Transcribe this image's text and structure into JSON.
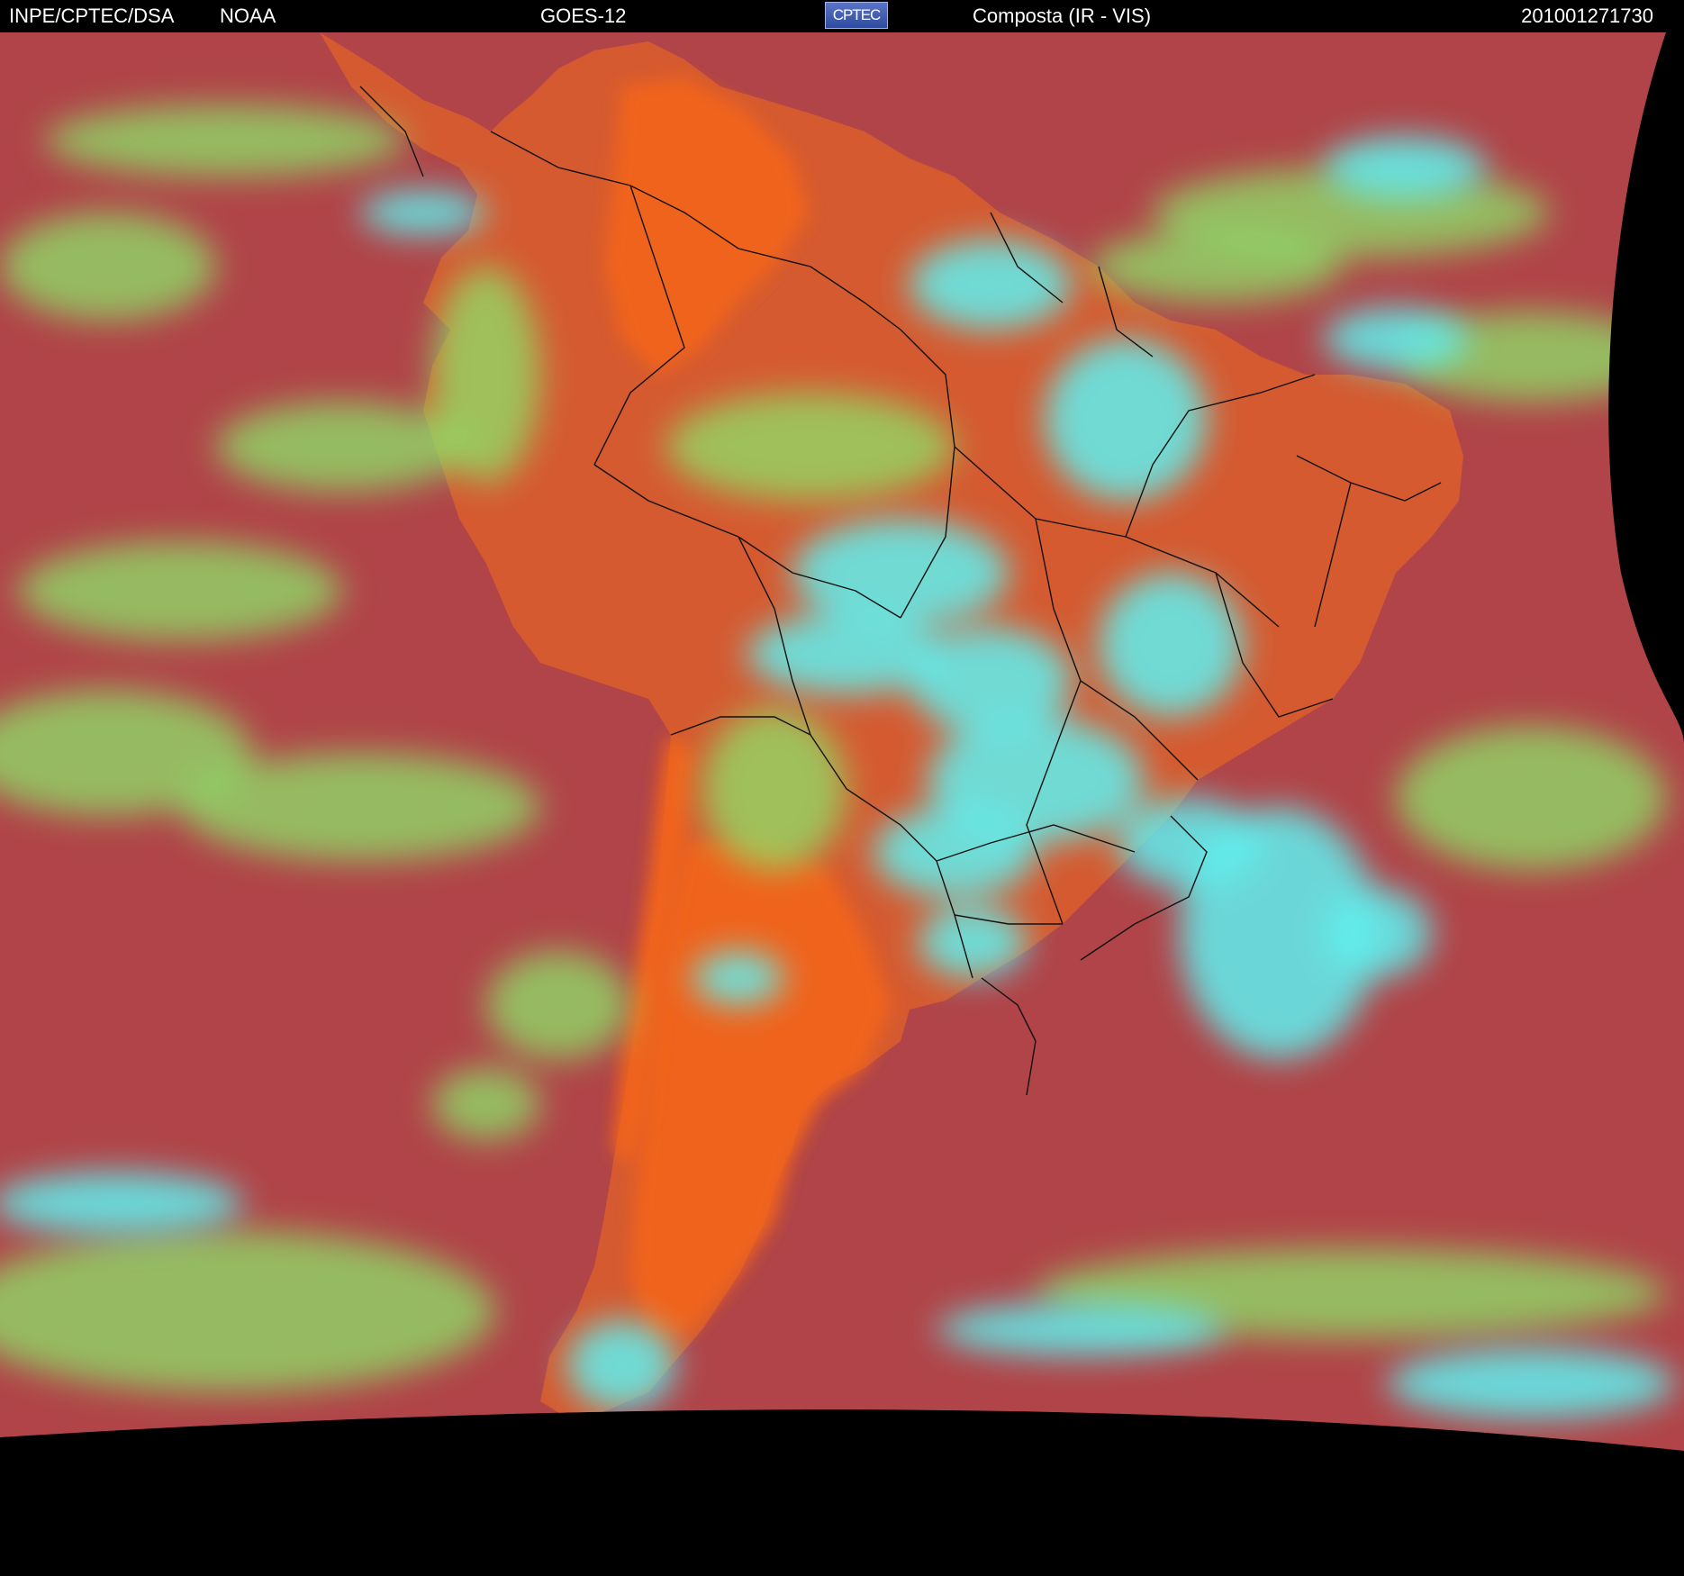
{
  "header": {
    "organization": "INPE/CPTEC/DSA",
    "agency": "NOAA",
    "satellite": "GOES-12",
    "logo_text": "CPTEC",
    "product": "Composta (IR - VIS)",
    "timestamp": "201001271730"
  },
  "map": {
    "region": "South America",
    "ocean_color": "#b04448",
    "land_color": "#d55a30",
    "arid_land_color": "#f0641a",
    "cloud_low_color": "#8ee26a",
    "cloud_high_color": "#5ff0f0",
    "no_data_color": "#000000",
    "border_color": "#111111"
  }
}
